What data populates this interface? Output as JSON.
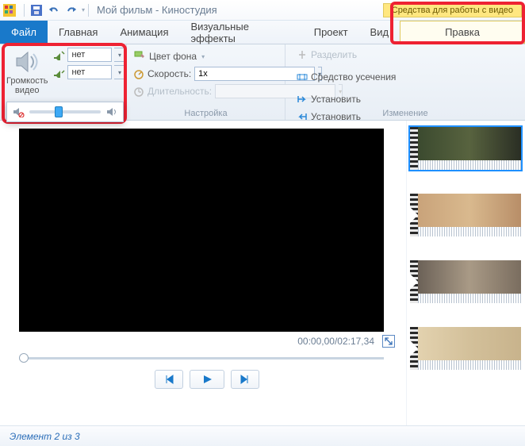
{
  "titlebar": {
    "title": "Мой фильм - Киностудия",
    "contextual_header": "Средства для работы с видео"
  },
  "tabs": {
    "file": "Файл",
    "items": [
      "Главная",
      "Анимация",
      "Визуальные эффекты",
      "Проект",
      "Вид"
    ],
    "contextual": "Правка"
  },
  "ribbon": {
    "volume": {
      "group_label": "видео",
      "label_top": "Громкость",
      "fade_in_value": "нет",
      "fade_out_value": "нет"
    },
    "adjust": {
      "bgcolor_label": "Цвет фона",
      "speed_label": "Скорость:",
      "speed_value": "1x",
      "duration_label": "Длительность:",
      "group_label": "Настройка"
    },
    "edit": {
      "split_label": "Разделить",
      "trim_label": "Средство усечения",
      "set_start_label": "Установить",
      "set_end_label": "Установить",
      "group_label": "Изменение"
    }
  },
  "preview": {
    "timecode": "00:00,00/02:17,34"
  },
  "status": {
    "text": "Элемент 2 из 3"
  }
}
